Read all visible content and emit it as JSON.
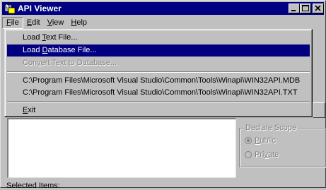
{
  "window": {
    "title": "API Viewer"
  },
  "menubar": {
    "items": [
      {
        "pre": "",
        "acc": "F",
        "post": "ile"
      },
      {
        "pre": "",
        "acc": "E",
        "post": "dit"
      },
      {
        "pre": "",
        "acc": "V",
        "post": "iew"
      },
      {
        "pre": "",
        "acc": "H",
        "post": "elp"
      }
    ]
  },
  "file_menu": {
    "load_text": {
      "pre": "Load ",
      "acc": "T",
      "post": "ext File..."
    },
    "load_database": {
      "pre": "Load ",
      "acc": "D",
      "post": "atabase File..."
    },
    "convert": {
      "pre": "Con",
      "acc": "v",
      "post": "ert Text to Database..."
    },
    "recent_mdb": "C:\\Program Files\\Microsoft Visual Studio\\Common\\Tools\\Winapi\\WIN32API.MDB",
    "recent_txt": "C:\\Program Files\\Microsoft Visual Studio\\Common\\Tools\\Winapi\\WIN32API.TXT",
    "exit": {
      "pre": "",
      "acc": "E",
      "post": "xit"
    }
  },
  "declare_scope": {
    "legend": "Declare Scope",
    "public": {
      "pre": "",
      "acc": "P",
      "post": "ublic"
    },
    "private": {
      "pre": "Pri",
      "acc": "v",
      "post": "ate"
    }
  },
  "selected_items_label": "Selected Items:",
  "colors": {
    "title_bar": "#000080",
    "highlight": "#000080",
    "face": "#c0c0c0"
  }
}
